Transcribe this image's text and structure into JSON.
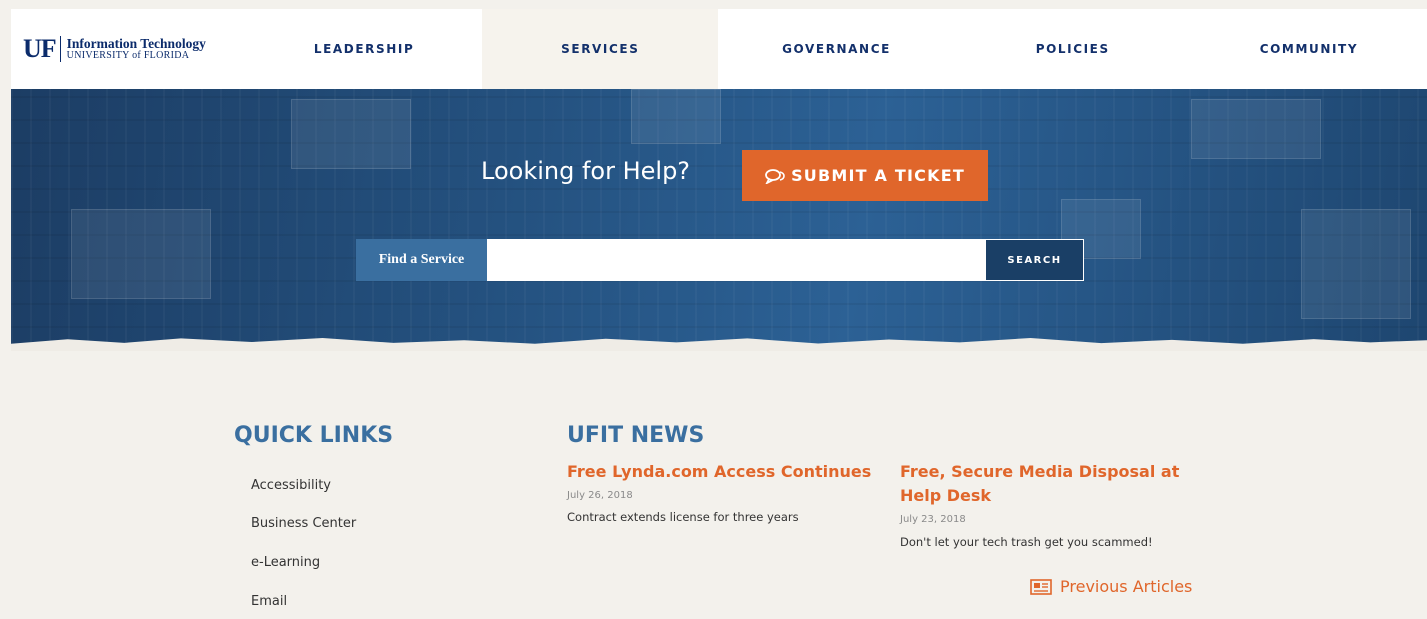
{
  "logo": {
    "mark": "UF",
    "line1": "Information Technology",
    "line2": "UNIVERSITY of FLORIDA"
  },
  "nav": {
    "items": [
      {
        "label": "LEADERSHIP"
      },
      {
        "label": "SERVICES"
      },
      {
        "label": "GOVERNANCE"
      },
      {
        "label": "POLICIES"
      },
      {
        "label": "COMMUNITY"
      }
    ],
    "active": "SERVICES"
  },
  "hero": {
    "help_title": "Looking for Help?",
    "ticket_button": "SUBMIT A TICKET",
    "search": {
      "label": "Find a Service",
      "value": "",
      "placeholder": "",
      "button": "SEARCH"
    }
  },
  "quick_links": {
    "title": "QUICK LINKS",
    "items": [
      "Accessibility",
      "Business Center",
      "e-Learning",
      "Email"
    ]
  },
  "news": {
    "title": "UFIT NEWS",
    "articles": [
      {
        "title": "Free Lynda.com Access Continues",
        "date": "July 26, 2018",
        "summary": "Contract extends license for three years"
      },
      {
        "title_line1": "Free, Secure Media Disposal at",
        "title_line2": "Help Desk",
        "date": "July 23, 2018",
        "summary": "Don't let your tech trash get you scammed!"
      }
    ],
    "previous_link": "Previous Articles"
  },
  "icons": {
    "ticket": "chat-bubbles-icon",
    "previous": "newspaper-icon"
  },
  "colors": {
    "navy": "#13306b",
    "accent_orange": "#e0662b",
    "blue": "#3a6fa0",
    "page_bg": "#f3f1ec"
  }
}
